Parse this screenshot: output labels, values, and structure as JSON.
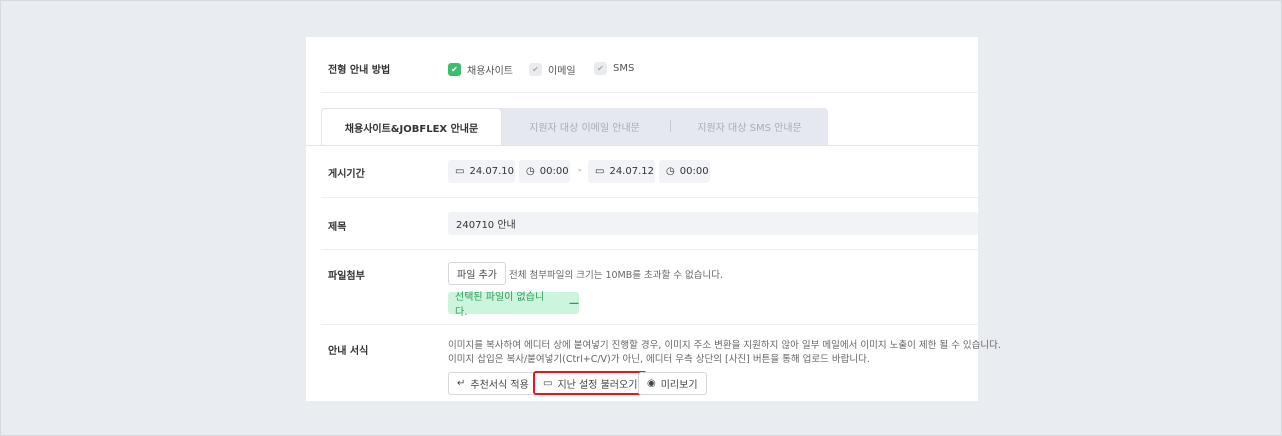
{
  "method": {
    "label": "전형 안내 방법",
    "options": [
      {
        "label": "채용사이트",
        "checked": true
      },
      {
        "label": "이메일",
        "checked": false
      },
      {
        "label": "SMS",
        "checked": false
      }
    ]
  },
  "tabs": [
    "채용사이트&JOBFLEX 안내문",
    "지원자 대상 이메일 안내문",
    "지원자 대상 SMS 안내문"
  ],
  "period": {
    "label": "게시기간",
    "start_date": "24.07.10",
    "start_time": "00:00",
    "separator": "-",
    "end_date": "24.07.12",
    "end_time": "00:00"
  },
  "title": {
    "label": "제목",
    "value": "240710 안내"
  },
  "attach": {
    "label": "파일첨부",
    "button": "파일 추가",
    "note": "전체 첨부파일의 크기는 10MB를 초과할 수 없습니다.",
    "empty": "선택된 파일이 없습니다.",
    "remove": "—"
  },
  "guide": {
    "label": "안내 서식",
    "note1": "이미지를 복사하여 에디터 상에 붙여넣기 진행할 경우, 이미지 주소 변환을 지원하지 않아 일부 메일에서 이미지 노출이 제한 될 수 있습니다.",
    "note2": "이미지 삽입은 복사/붙여넣기(Ctrl+C/V)가 아닌, 에디터 우측 상단의 [사진] 버튼을 통해 업로드 바랍니다.",
    "buttons": [
      "추천서식 적용",
      "지난 설정 불러오기",
      "미리보기"
    ]
  }
}
